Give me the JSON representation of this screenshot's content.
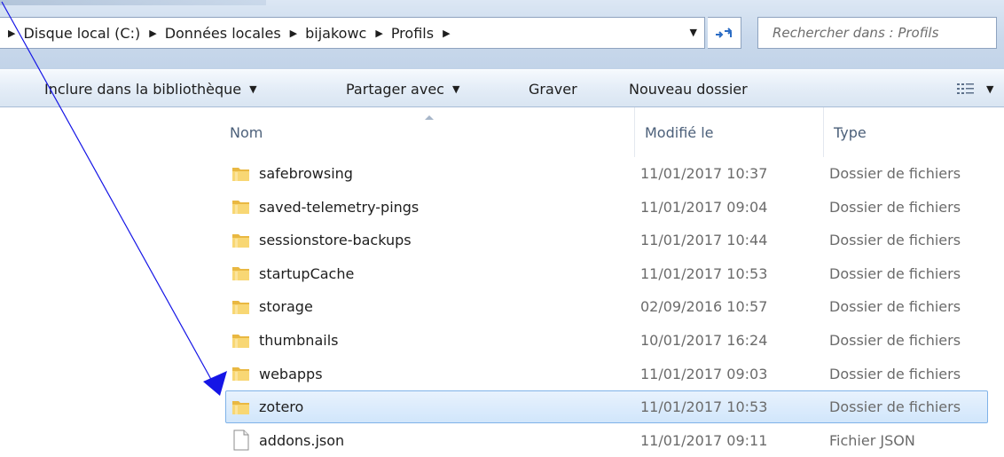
{
  "address_bar": {
    "breadcrumbs": [
      "Disque local (C:)",
      "Données locales",
      "bijakowc",
      "Profils"
    ],
    "search_placeholder": "Rechercher dans : Profils",
    "dropdown_icon": "chevron-down-icon",
    "refresh_icon": "refresh-icon"
  },
  "toolbar": {
    "include_label": "Inclure dans la bibliothèque",
    "share_label": "Partager avec",
    "burn_label": "Graver",
    "new_folder_label": "Nouveau dossier",
    "view_icon": "view-options-icon"
  },
  "columns": {
    "name": "Nom",
    "modified": "Modifié le",
    "type": "Type"
  },
  "files": [
    {
      "name": "safebrowsing",
      "modified": "11/01/2017 10:37",
      "type": "Dossier de fichiers",
      "icon": "folder-icon",
      "selected": false
    },
    {
      "name": "saved-telemetry-pings",
      "modified": "11/01/2017 09:04",
      "type": "Dossier de fichiers",
      "icon": "folder-icon",
      "selected": false
    },
    {
      "name": "sessionstore-backups",
      "modified": "11/01/2017 10:44",
      "type": "Dossier de fichiers",
      "icon": "folder-icon",
      "selected": false
    },
    {
      "name": "startupCache",
      "modified": "11/01/2017 10:53",
      "type": "Dossier de fichiers",
      "icon": "folder-icon",
      "selected": false
    },
    {
      "name": "storage",
      "modified": "02/09/2016 10:57",
      "type": "Dossier de fichiers",
      "icon": "folder-icon",
      "selected": false
    },
    {
      "name": "thumbnails",
      "modified": "10/01/2017 16:24",
      "type": "Dossier de fichiers",
      "icon": "folder-icon",
      "selected": false
    },
    {
      "name": "webapps",
      "modified": "11/01/2017 09:03",
      "type": "Dossier de fichiers",
      "icon": "folder-icon",
      "selected": false
    },
    {
      "name": "zotero",
      "modified": "11/01/2017 10:53",
      "type": "Dossier de fichiers",
      "icon": "folder-icon",
      "selected": true
    },
    {
      "name": "addons.json",
      "modified": "11/01/2017 09:11",
      "type": "Fichier JSON",
      "icon": "file-icon",
      "selected": false
    }
  ],
  "colors": {
    "selection_fill": "#d9ebfc",
    "selection_border": "#7fb2e8",
    "annotation_arrow": "#1515e6",
    "folder": "#f5c95a"
  }
}
